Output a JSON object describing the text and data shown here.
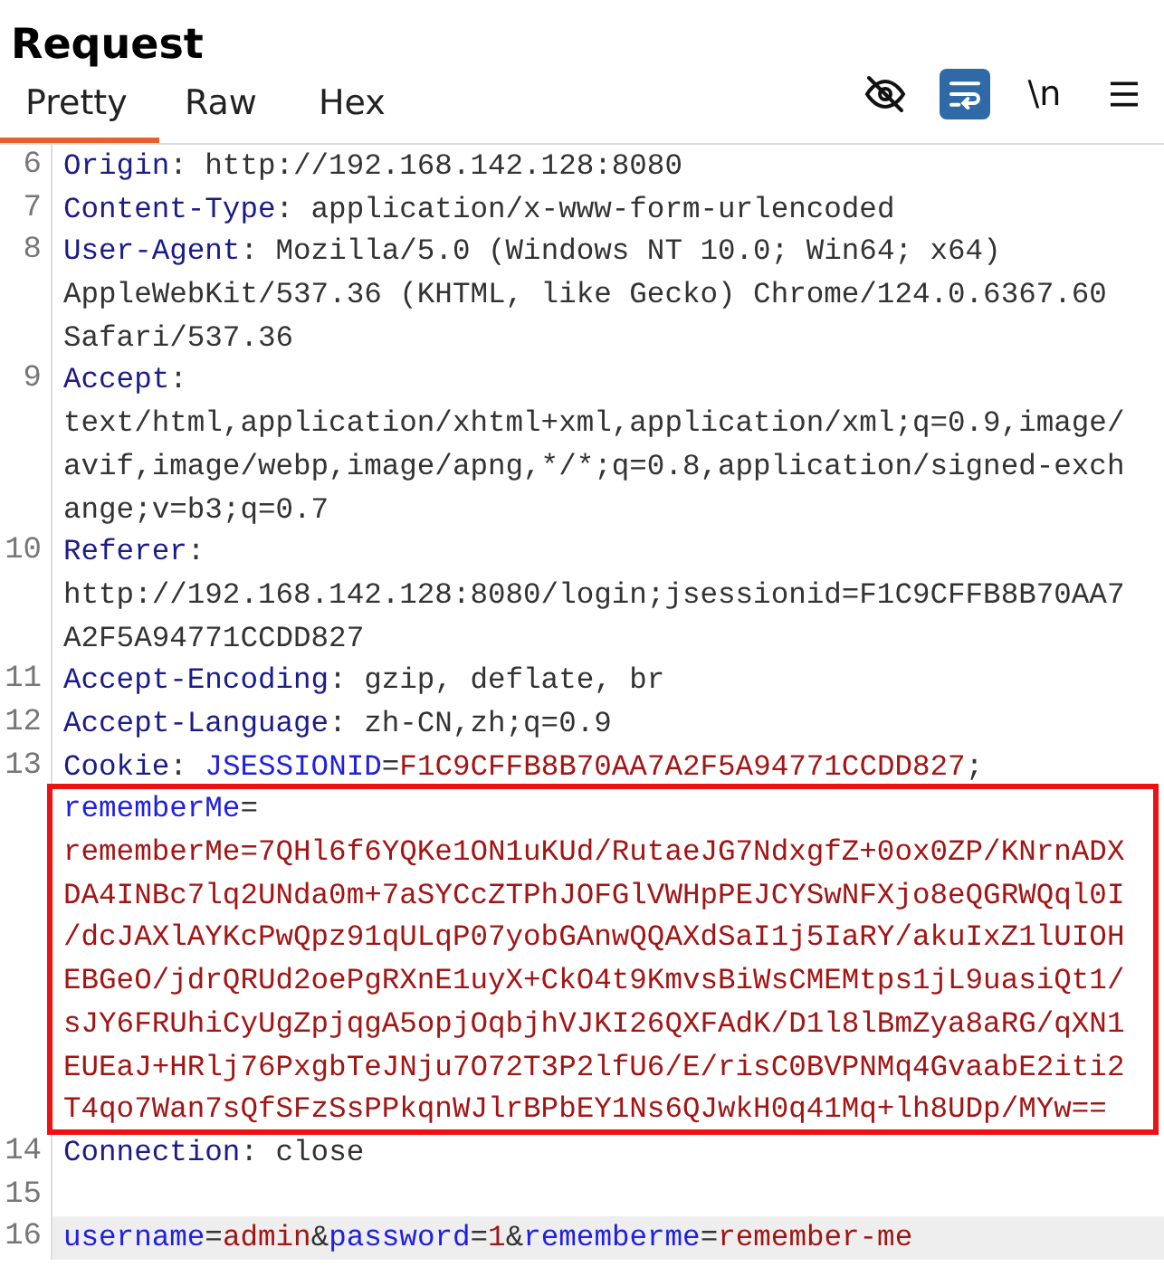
{
  "title": "Request",
  "tabs": [
    {
      "label": "Pretty",
      "selected": true
    },
    {
      "label": "Raw",
      "selected": false
    },
    {
      "label": "Hex",
      "selected": false
    }
  ],
  "toolbar": [
    {
      "kind": "hide",
      "on": false
    },
    {
      "kind": "wrap",
      "on": true
    },
    {
      "kind": "newline",
      "label": "\\n",
      "on": false
    },
    {
      "kind": "menu"
    }
  ],
  "lines": [
    {
      "number": "6",
      "rows": [
        {
          "tokens": [
            {
              "color": "#1b1b8a",
              "text": "Origin"
            },
            {
              "color": "#333333",
              "text": ": http://192.168.142.128:8080"
            }
          ]
        }
      ]
    },
    {
      "number": "7",
      "rows": [
        {
          "tokens": [
            {
              "color": "#1b1b8a",
              "text": "Content-Type"
            },
            {
              "color": "#333333",
              "text": ": application/x-www-form-urlencoded"
            }
          ]
        }
      ]
    },
    {
      "number": "8",
      "rows": [
        {
          "tokens": [
            {
              "color": "#1b1b8a",
              "text": "User-Agent"
            },
            {
              "color": "#333333",
              "text": ": Mozilla/5.0 (Windows NT 10.0; Win64; x64)"
            }
          ]
        },
        {
          "tokens": [
            {
              "color": "#333333",
              "text": "AppleWebKit/537.36 (KHTML, like Gecko) Chrome/124.0.6367.60"
            }
          ]
        },
        {
          "tokens": [
            {
              "color": "#333333",
              "text": "Safari/537.36"
            }
          ]
        }
      ]
    },
    {
      "number": "9",
      "rows": [
        {
          "tokens": [
            {
              "color": "#1b1b8a",
              "text": "Accept"
            },
            {
              "color": "#333333",
              "text": ":"
            }
          ]
        },
        {
          "tokens": [
            {
              "color": "#333333",
              "text": "text/html,application/xhtml+xml,application/xml;q=0.9,image/"
            }
          ]
        },
        {
          "tokens": [
            {
              "color": "#333333",
              "text": "avif,image/webp,image/apng,*/*;q=0.8,application/signed-exch"
            }
          ]
        },
        {
          "tokens": [
            {
              "color": "#333333",
              "text": "ange;v=b3;q=0.7"
            }
          ]
        }
      ]
    },
    {
      "number": "10",
      "rows": [
        {
          "tokens": [
            {
              "color": "#1b1b8a",
              "text": "Referer"
            },
            {
              "color": "#333333",
              "text": ":"
            }
          ]
        },
        {
          "tokens": [
            {
              "color": "#333333",
              "text": "http://192.168.142.128:8080/login;jsessionid=F1C9CFFB8B70AA7"
            }
          ]
        },
        {
          "tokens": [
            {
              "color": "#333333",
              "text": "A2F5A94771CCDD827"
            }
          ]
        }
      ]
    },
    {
      "number": "11",
      "rows": [
        {
          "tokens": [
            {
              "color": "#1b1b8a",
              "text": "Accept-Encoding"
            },
            {
              "color": "#333333",
              "text": ": gzip, deflate, br"
            }
          ]
        }
      ]
    },
    {
      "number": "12",
      "rows": [
        {
          "tokens": [
            {
              "color": "#1b1b8a",
              "text": "Accept-Language"
            },
            {
              "color": "#333333",
              "text": ": zh-CN,zh;q=0.9"
            }
          ]
        }
      ]
    },
    {
      "number": "13",
      "rows": [
        {
          "tokens": [
            {
              "color": "#1b1b8a",
              "text": "Cookie"
            },
            {
              "color": "#333333",
              "text": ": "
            },
            {
              "color": "#2020e0",
              "text": "JSESSIONID"
            },
            {
              "color": "#333333",
              "text": "="
            },
            {
              "color": "#a31515",
              "text": "F1C9CFFB8B70AA7A2F5A94771CCDD827"
            },
            {
              "color": "#333333",
              "text": ";"
            }
          ]
        }
      ],
      "boxed_rows": [
        {
          "tokens": [
            {
              "color": "#2020e0",
              "text": "rememberMe"
            },
            {
              "color": "#333333",
              "text": "="
            }
          ]
        },
        {
          "tokens": [
            {
              "color": "#a31515",
              "text": "rememberMe=7QHl6f6YQKe1ON1uKUd/RutaeJG7NdxgfZ+0ox0ZP/KNrnADX"
            }
          ]
        },
        {
          "tokens": [
            {
              "color": "#a31515",
              "text": "DA4INBc7lq2UNda0m+7aSYCcZTPhJOFGlVWHpPEJCYSwNFXjo8eQGRWQql0I"
            }
          ]
        },
        {
          "tokens": [
            {
              "color": "#a31515",
              "text": "/dcJAXlAYKcPwQpz91qULqP07yobGAnwQQAXdSaI1j5IaRY/akuIxZ1lUIOH"
            }
          ]
        },
        {
          "tokens": [
            {
              "color": "#a31515",
              "text": "EBGeO/jdrQRUd2oePgRXnE1uyX+CkO4t9KmvsBiWsCMEMtps1jL9uasiQt1/"
            }
          ]
        },
        {
          "tokens": [
            {
              "color": "#a31515",
              "text": "sJY6FRUhiCyUgZpjqgA5opjOqbjhVJKI26QXFAdK/D1l8lBmZya8aRG/qXN1"
            }
          ]
        },
        {
          "tokens": [
            {
              "color": "#a31515",
              "text": "EUEaJ+HRlj76PxgbTeJNju7O72T3P2lfU6/E/risC0BVPNMq4GvaabE2iti2"
            }
          ]
        },
        {
          "tokens": [
            {
              "color": "#a31515",
              "text": "T4qo7Wan7sQfSFzSsPPkqnWJlrBPbEY1Ns6QJwkH0q41Mq+lh8UDp/MYw=="
            }
          ]
        }
      ]
    },
    {
      "number": "14",
      "rows": [
        {
          "tokens": [
            {
              "color": "#1b1b8a",
              "text": "Connection"
            },
            {
              "color": "#333333",
              "text": ": close"
            }
          ]
        }
      ]
    },
    {
      "number": "15"
    },
    {
      "number": "16",
      "current": true,
      "rows": [
        {
          "tokens": [
            {
              "color": "#2020e0",
              "text": "username"
            },
            {
              "color": "#333333",
              "text": "="
            },
            {
              "color": "#a31515",
              "text": "admin"
            },
            {
              "color": "#333333",
              "text": "&"
            },
            {
              "color": "#2020e0",
              "text": "password"
            },
            {
              "color": "#333333",
              "text": "="
            },
            {
              "color": "#a31515",
              "text": "1"
            },
            {
              "color": "#333333",
              "text": "&"
            },
            {
              "color": "#2020e0",
              "text": "rememberme"
            },
            {
              "color": "#333333",
              "text": "="
            },
            {
              "color": "#a31515",
              "text": "remember-me"
            }
          ]
        }
      ]
    }
  ]
}
